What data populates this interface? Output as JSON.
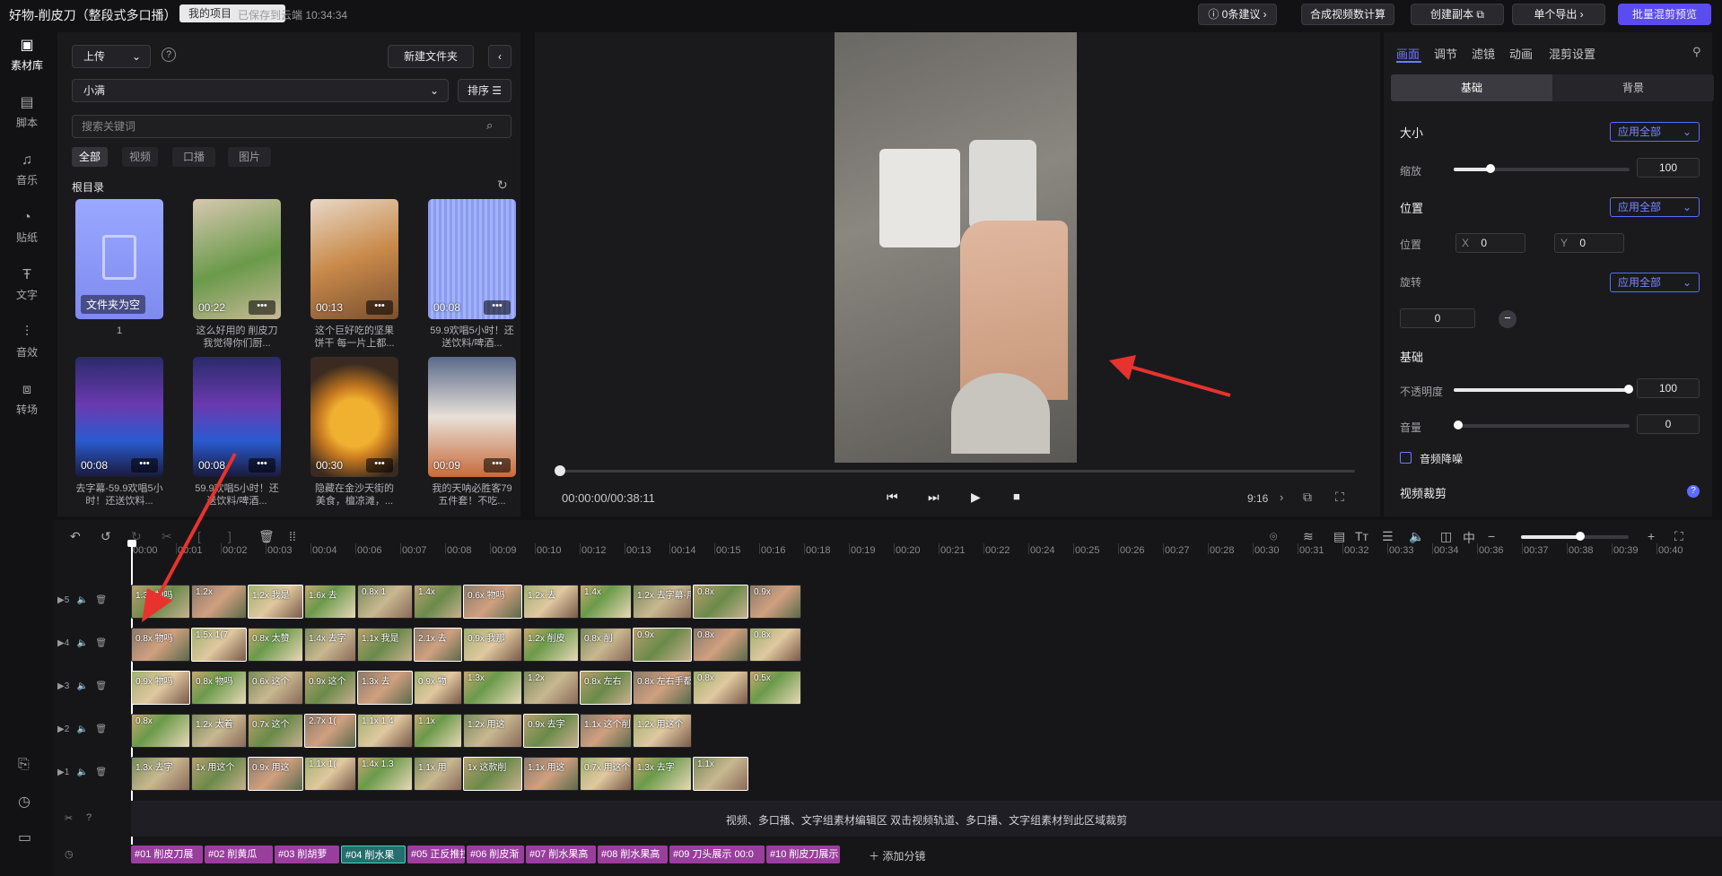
{
  "titlebar": {
    "title": "好物-削皮刀（整段式多口播）",
    "tag1": "多口播",
    "tag2": "我的项目",
    "save_status": "已保存到云端 10:34:34",
    "buttons": [
      "0条建议 ›",
      "合成视频数计算",
      "创建副本",
      "单个导出 ›",
      "批量混剪预览"
    ]
  },
  "leftnav": {
    "items": [
      {
        "label": "素材库",
        "icon": "library-icon"
      },
      {
        "label": "脚本",
        "icon": "script-icon"
      },
      {
        "label": "音乐",
        "icon": "music-icon"
      },
      {
        "label": "贴纸",
        "icon": "sticker-icon"
      },
      {
        "label": "文字",
        "icon": "text-icon"
      },
      {
        "label": "音效",
        "icon": "sound-effect-icon"
      },
      {
        "label": "转场",
        "icon": "transition-icon"
      }
    ]
  },
  "library": {
    "upload_label": "上传",
    "new_folder_label": "新建文件夹",
    "folder_select": "小满",
    "sort_label": "排序",
    "search_placeholder": "搜索关键词",
    "chips": [
      "全部",
      "视频",
      "口播",
      "图片"
    ],
    "root_label": "根目录",
    "items": [
      {
        "duration": "",
        "caption": "1",
        "overlay": "文件夹为空"
      },
      {
        "duration": "00:22",
        "caption": "这么好用的 削皮刀 我觉得你们厨..."
      },
      {
        "duration": "00:13",
        "caption": "这个巨好吃的坚果饼干 每一片上都..."
      },
      {
        "duration": "00:08",
        "caption": "59.9欢唱5小时！还送饮料/啤酒..."
      },
      {
        "duration": "00:08",
        "caption": "去字幕-59.9欢唱5小时！还送饮料..."
      },
      {
        "duration": "00:08",
        "caption": "59.9欢唱5小时！还送饮料/啤酒..."
      },
      {
        "duration": "00:30",
        "caption": "隐藏在金沙天街的美食，檀凉滩，..."
      },
      {
        "duration": "00:09",
        "caption": "我的天呐必胜客79五件套！不吃..."
      }
    ]
  },
  "preview": {
    "time": "00:00:00/00:38:11",
    "ratio": "9:16"
  },
  "props": {
    "tabs": [
      "画面",
      "调节",
      "滤镜",
      "动画",
      "混剪设置"
    ],
    "subtabs": [
      "基础",
      "背景"
    ],
    "size_head": "大小",
    "scale_label": "缩放",
    "scale_value": "100",
    "position_head": "位置",
    "position_label": "位置",
    "x_label": "X",
    "x_value": "0",
    "y_label": "Y",
    "y_value": "0",
    "rotate_label": "旋转",
    "rotate_value": "0",
    "basic_head": "基础",
    "opacity_label": "不透明度",
    "opacity_value": "100",
    "volume_label": "音量",
    "volume_value": "0",
    "denoise_label": "音频降噪",
    "crop_head": "视频裁剪",
    "apply_all": "应用全部"
  },
  "timeline": {
    "ruler": [
      "00:00",
      "00:01",
      "00:02",
      "00:03",
      "00:04",
      "00:06",
      "00:07",
      "00:08",
      "00:09",
      "00:10",
      "00:12",
      "00:13",
      "00:14",
      "00:15",
      "00:16",
      "00:18",
      "00:19",
      "00:20",
      "00:21",
      "00:22",
      "00:24",
      "00:25",
      "00:26",
      "00:27",
      "00:28",
      "00:30",
      "00:31",
      "00:32",
      "00:33",
      "00:34",
      "00:36",
      "00:37",
      "00:38",
      "00:39",
      "00:40"
    ],
    "tracks": [
      {
        "label": "5",
        "clips": [
          "1.3x 物吗",
          "1.2x",
          "1.2x 我是",
          "1.6x 去",
          "0.8x 1",
          "1.4x",
          "0.6x 物吗",
          "1.2x 去",
          "1.4x",
          "1.2x 去字幕-用",
          "0.8x",
          "0.9x"
        ]
      },
      {
        "label": "4",
        "clips": [
          "0.8x 物吗",
          "1.5x 1(7",
          "0.8x 太赞",
          "1.4x 去字",
          "1.1x 我是",
          "2.1x 去",
          "0.9x 我那",
          "1.2x 削皮",
          "0.8x 削",
          "0.9x",
          "0.8x",
          "0.8x"
        ]
      },
      {
        "label": "3",
        "clips": [
          "0.9x 物吗",
          "0.8x 物吗",
          "0.6x 这个",
          "0.9x 这个",
          "1.3x 去",
          "0.9x 物",
          "1.3x",
          "1.2x",
          "0.8x 左右",
          "0.8x 左右手都",
          "0.8x",
          "0.5x"
        ]
      },
      {
        "label": "2",
        "clips": [
          "0.8x",
          "1.2x 太着",
          "0.7x 这个",
          "2.7x 1(",
          "1.1x 1.4",
          "1.1x",
          "1.2x 用这",
          "0.9x 去字",
          "1.1x 这个削皮",
          "1.2x 用这个"
        ]
      },
      {
        "label": "1",
        "clips": [
          "1.3x 去字",
          "1x 用这个",
          "0.9x 用这",
          "1.1x 1(",
          "1.4x 1.3",
          "1.1x 用",
          "1x 这款削",
          "1.1x 用这",
          "0.7x 用这个削",
          "1.3x 去字",
          "1.1x"
        ]
      }
    ],
    "empty_hint": "视频、多口播、文字组素材编辑区  双击视频轨道、多口播、文字组素材到此区域裁剪",
    "segments": [
      "#01 削皮刀展",
      "#02 削黄瓜",
      "#03 削胡萝",
      "#04 削水果",
      "#05 正反推拉",
      "#06 削皮渐",
      "#07 削水果高",
      "#08 削水果高",
      "#09 刀头展示 00:0",
      "#10 削皮刀展示"
    ],
    "add_segment": "添加分镜"
  }
}
